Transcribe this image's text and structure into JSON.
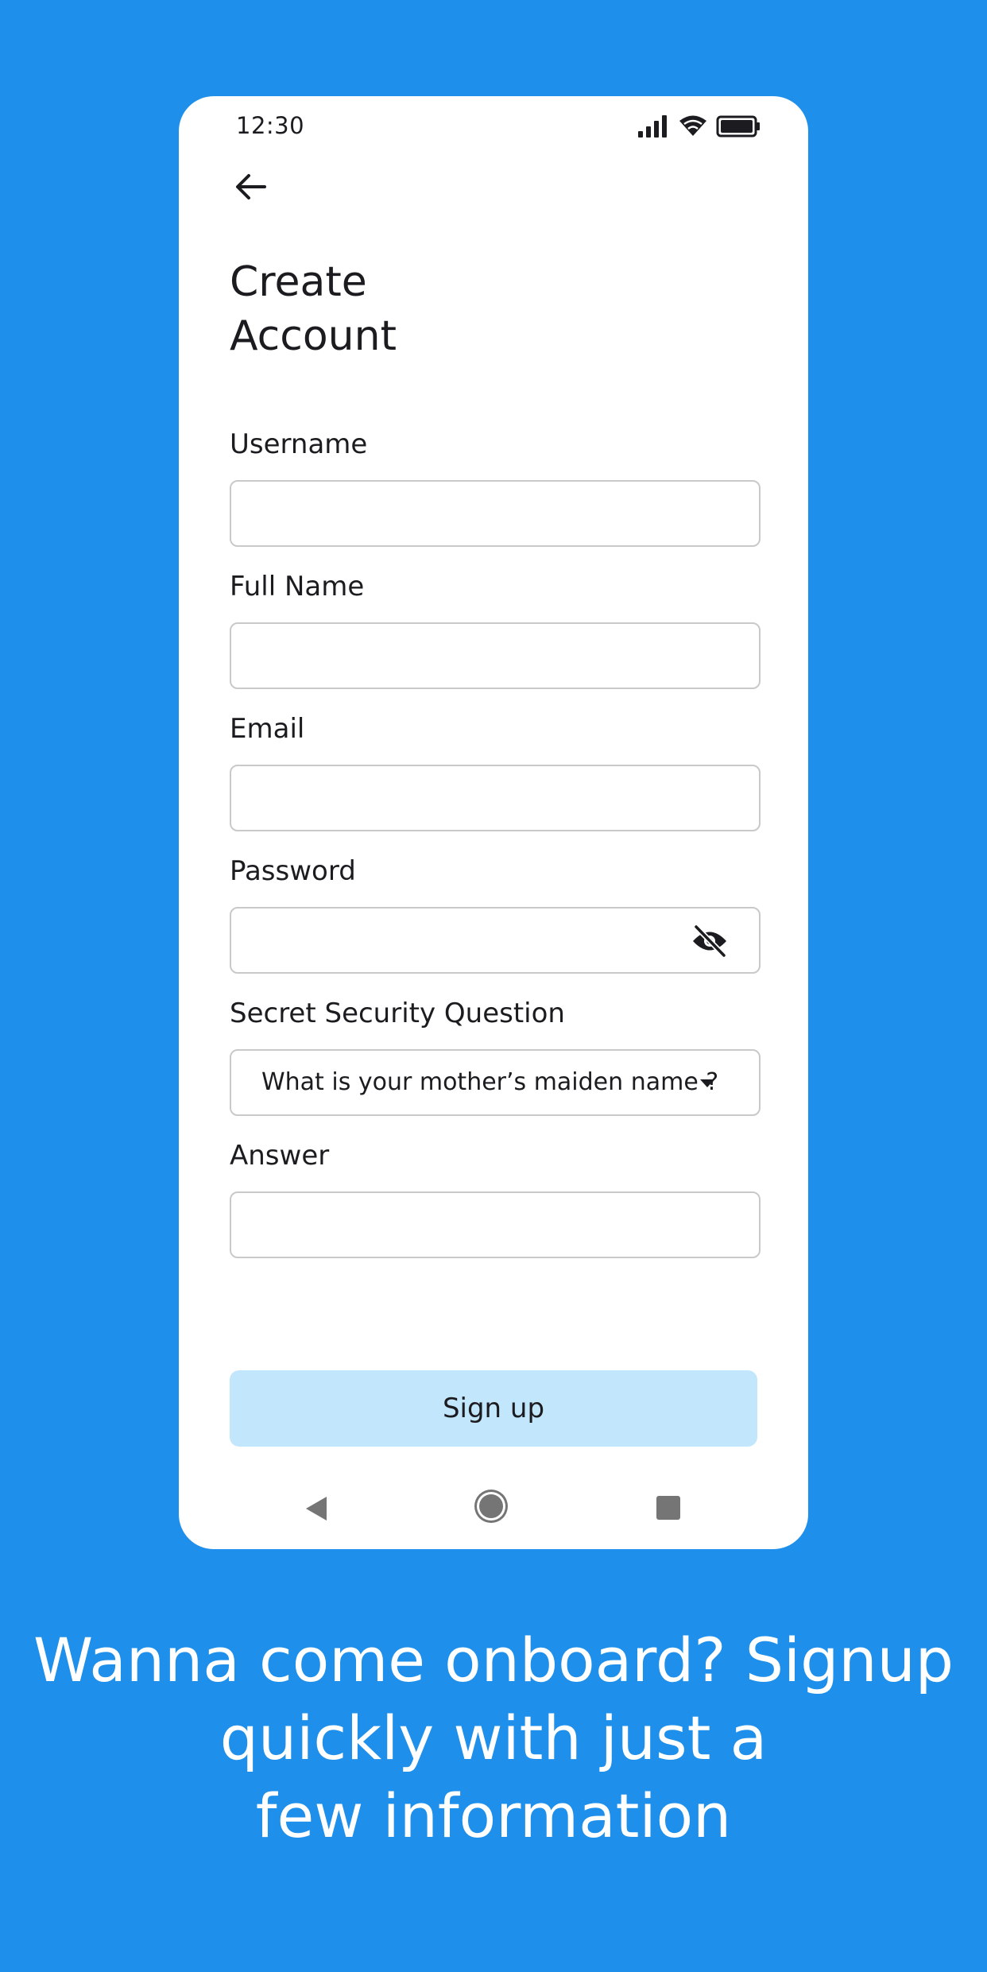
{
  "status_bar": {
    "time": "12:30",
    "icons": [
      "signal-icon",
      "wifi-icon",
      "battery-icon"
    ]
  },
  "header": {
    "back_icon": "arrow-left-icon",
    "title_line1": "Create",
    "title_line2": "Account"
  },
  "form": {
    "username_label": "Username",
    "username_value": "",
    "fullname_label": "Full Name",
    "fullname_value": "",
    "email_label": "Email",
    "email_value": "",
    "password_label": "Password",
    "password_value": "",
    "password_toggle_icon": "eye-off-icon",
    "security_question_label": "Secret Security Question",
    "security_question_selected": "What is your mother’s maiden name ?",
    "answer_label": "Answer",
    "answer_value": "",
    "signup_label": "Sign up"
  },
  "nav_bar": {
    "icons": [
      "nav-back-icon",
      "nav-home-icon",
      "nav-recents-icon"
    ]
  },
  "tagline": {
    "line1": "Wanna come onboard? Signup",
    "line2": "quickly with just a",
    "line3": "few information"
  },
  "colors": {
    "background": "#1e8fea",
    "card": "#ffffff",
    "button": "#c2e6fc",
    "text": "#1c1b1f"
  }
}
